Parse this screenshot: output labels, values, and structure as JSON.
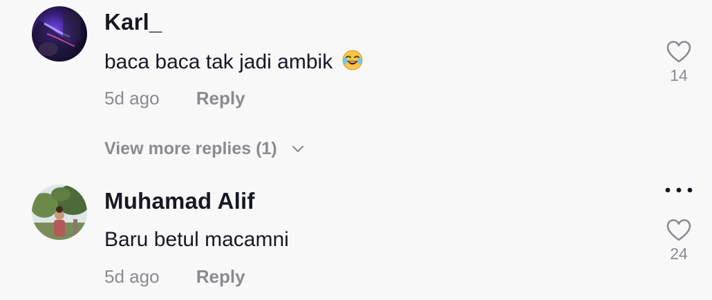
{
  "comments": [
    {
      "username": "Karl_",
      "text": "baca baca tak jadi ambik",
      "emoji": "face-with-tears-of-joy",
      "time": "5d ago",
      "reply_label": "Reply",
      "likes": "14",
      "view_more_replies": "View more replies (1)"
    },
    {
      "username": "Muhamad Alif",
      "text": "Baru betul macamni",
      "time": "5d ago",
      "reply_label": "Reply",
      "likes": "24"
    }
  ],
  "colors": {
    "background": "#f8f8f8",
    "primary_text": "#161823",
    "secondary_text": "#8a8b91",
    "icon": "#8a8b91"
  }
}
